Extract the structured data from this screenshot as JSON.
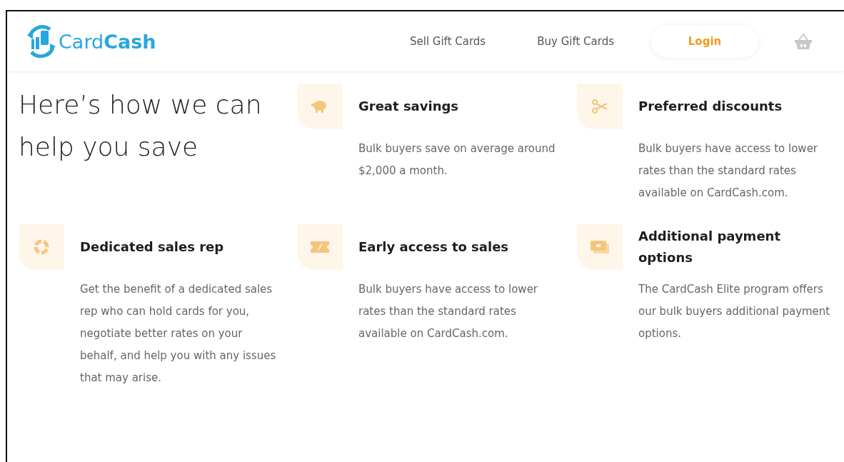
{
  "logo": {
    "light": "Card",
    "bold": "Cash"
  },
  "nav": [
    "Sell Gift Cards",
    "Buy Gift Cards"
  ],
  "login": "Login",
  "heading": "Here’s how we can help you save",
  "features": [
    {
      "kind": "piggy",
      "title": "Great savings",
      "text": "Bulk buyers save on average around $2,000 a month."
    },
    {
      "kind": "scissors",
      "title": "Preferred discounts",
      "text": "Bulk buyers have access to lower rates than the standard rates available on CardCash.com."
    },
    {
      "kind": "lifebuoy",
      "title": "Dedicated sales rep",
      "text": "Get the benefit of a dedicated sales rep who can hold cards for you, negotiate better rates on your behalf, and help you with any issues that may arise."
    },
    {
      "kind": "ticket",
      "title": "Early access to sales",
      "text": "Bulk buyers have access to lower rates than the standard rates available on CardCash.com."
    },
    {
      "kind": "cash",
      "title": "Additional payment options",
      "text": "The CardCash Elite program offers our bulk buyers additional payment options."
    }
  ]
}
